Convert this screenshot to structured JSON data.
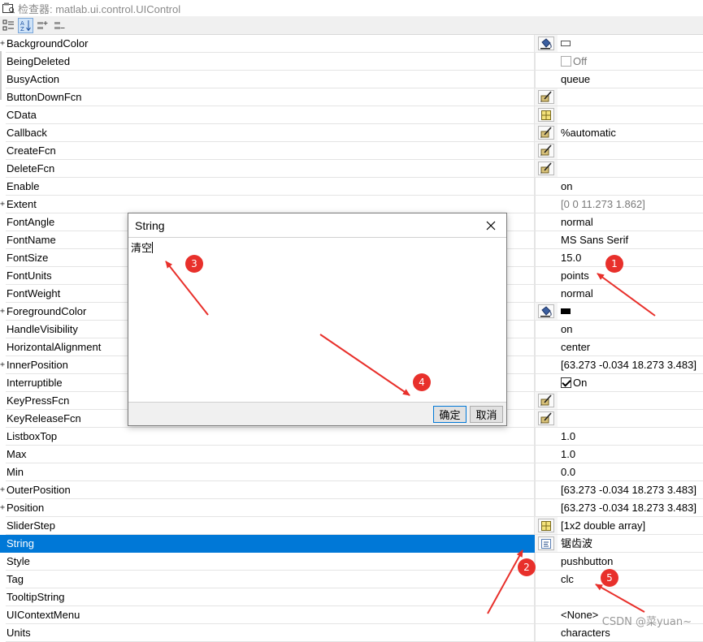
{
  "window": {
    "title": "检查器: matlab.ui.control.UIControl"
  },
  "toolbar": {
    "buttons": [
      {
        "icon": "categorized-view-icon",
        "active": false
      },
      {
        "icon": "sort-alpha-icon",
        "active": true
      },
      {
        "icon": "expand-all-icon",
        "active": false
      },
      {
        "icon": "collapse-all-icon",
        "active": false
      }
    ]
  },
  "properties": [
    {
      "name": "BackgroundColor",
      "expandable": true,
      "button": "paint-bucket-icon",
      "value": "",
      "value_kind": "swatch-white"
    },
    {
      "name": "BeingDeleted",
      "expandable": false,
      "button": "",
      "value": "Off",
      "value_kind": "checkbox-off"
    },
    {
      "name": "BusyAction",
      "expandable": false,
      "button": "",
      "value": "queue"
    },
    {
      "name": "ButtonDownFcn",
      "expandable": false,
      "button": "edit-fcn-icon",
      "value": ""
    },
    {
      "name": "CData",
      "expandable": false,
      "button": "array-editor-icon",
      "value": ""
    },
    {
      "name": "Callback",
      "expandable": false,
      "button": "edit-fcn-icon",
      "value": "%automatic"
    },
    {
      "name": "CreateFcn",
      "expandable": false,
      "button": "edit-fcn-icon",
      "value": ""
    },
    {
      "name": "DeleteFcn",
      "expandable": false,
      "button": "edit-fcn-icon",
      "value": ""
    },
    {
      "name": "Enable",
      "expandable": false,
      "button": "",
      "value": "on"
    },
    {
      "name": "Extent",
      "expandable": true,
      "button": "",
      "value": "[0 0 11.273 1.862]",
      "gray": true
    },
    {
      "name": "FontAngle",
      "expandable": false,
      "button": "",
      "value": "normal"
    },
    {
      "name": "FontName",
      "expandable": false,
      "button": "",
      "value": "MS Sans Serif"
    },
    {
      "name": "FontSize",
      "expandable": false,
      "button": "",
      "value": "15.0"
    },
    {
      "name": "FontUnits",
      "expandable": false,
      "button": "",
      "value": "points"
    },
    {
      "name": "FontWeight",
      "expandable": false,
      "button": "",
      "value": "normal"
    },
    {
      "name": "ForegroundColor",
      "expandable": true,
      "button": "paint-bucket-icon",
      "value": "",
      "value_kind": "swatch-black"
    },
    {
      "name": "HandleVisibility",
      "expandable": false,
      "button": "",
      "value": "on"
    },
    {
      "name": "HorizontalAlignment",
      "expandable": false,
      "button": "",
      "value": "center"
    },
    {
      "name": "InnerPosition",
      "expandable": true,
      "button": "",
      "value": "[63.273 -0.034 18.273 3.483]"
    },
    {
      "name": "Interruptible",
      "expandable": false,
      "button": "",
      "value": "On",
      "value_kind": "checkbox-on"
    },
    {
      "name": "KeyPressFcn",
      "expandable": false,
      "button": "edit-fcn-icon",
      "value": ""
    },
    {
      "name": "KeyReleaseFcn",
      "expandable": false,
      "button": "edit-fcn-icon",
      "value": ""
    },
    {
      "name": "ListboxTop",
      "expandable": false,
      "button": "",
      "value": "1.0"
    },
    {
      "name": "Max",
      "expandable": false,
      "button": "",
      "value": "1.0"
    },
    {
      "name": "Min",
      "expandable": false,
      "button": "",
      "value": "0.0"
    },
    {
      "name": "OuterPosition",
      "expandable": true,
      "button": "",
      "value": "[63.273 -0.034 18.273 3.483]"
    },
    {
      "name": "Position",
      "expandable": true,
      "button": "",
      "value": "[63.273 -0.034 18.273 3.483]"
    },
    {
      "name": "SliderStep",
      "expandable": false,
      "button": "array-editor-icon",
      "value": "[1x2  double array]"
    },
    {
      "name": "String",
      "expandable": false,
      "button": "string-editor-icon",
      "value": "锯齿波",
      "selected": true
    },
    {
      "name": "Style",
      "expandable": false,
      "button": "",
      "value": "pushbutton"
    },
    {
      "name": "Tag",
      "expandable": false,
      "button": "",
      "value": "clc"
    },
    {
      "name": "TooltipString",
      "expandable": false,
      "button": "",
      "value": ""
    },
    {
      "name": "UIContextMenu",
      "expandable": false,
      "button": "",
      "value": "<None>"
    },
    {
      "name": "Units",
      "expandable": false,
      "button": "",
      "value": "characters"
    }
  ],
  "dialog": {
    "title": "String",
    "text": "清空",
    "ok_label": "确定",
    "cancel_label": "取消"
  },
  "annotations": {
    "color": "#e8302b",
    "badges": [
      "1",
      "2",
      "3",
      "4",
      "5"
    ]
  },
  "watermark": "CSDN @菜yuan~",
  "colors": {
    "selection": "#0078d7",
    "annotation": "#e8302b"
  }
}
